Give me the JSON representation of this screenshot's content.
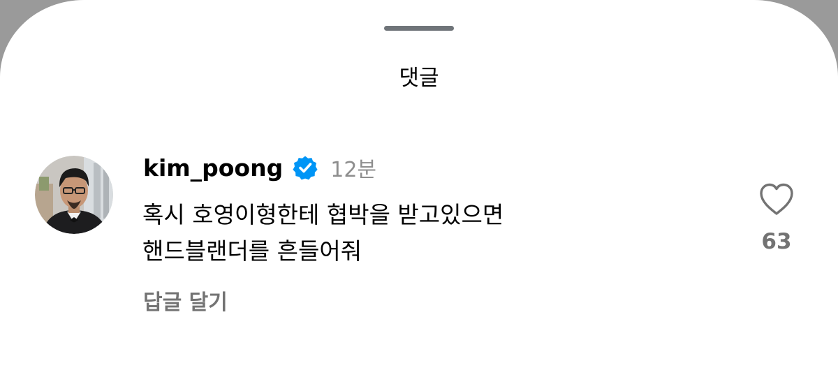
{
  "sheet": {
    "title": "댓글"
  },
  "comment": {
    "username": "kim_poong",
    "verified": true,
    "timestamp": "12분",
    "text": "혹시 호영이형한테 협박을 받고있으면\n핸드블랜더를 흔들어줘",
    "reply_label": "답글 달기",
    "like_count": "63",
    "icons": {
      "avatar": "profile-photo",
      "verified": "verified-badge-icon",
      "like": "heart-outline-icon"
    }
  },
  "colors": {
    "verified": "#0095f6",
    "muted_text": "#737373",
    "timestamp": "#8e8e8e",
    "handle": "#6f7479"
  }
}
